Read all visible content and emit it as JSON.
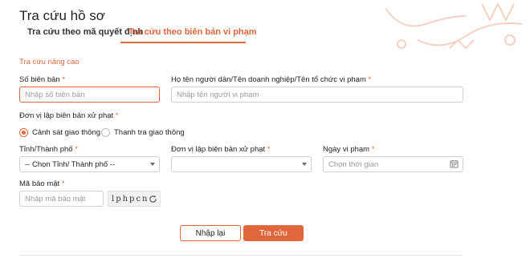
{
  "page": {
    "title": "Tra cứu hồ sơ"
  },
  "tabs": [
    {
      "label": "Tra cứu theo mã quyết định",
      "active": false
    },
    {
      "label": "Tra cứu theo biên bản vi phạm",
      "active": true
    }
  ],
  "section": {
    "label": "Tra cứu nâng cao"
  },
  "form": {
    "so_bien_ban": {
      "label": "Số biên bản",
      "required": "*",
      "placeholder": "Nhập số biên bản",
      "value": ""
    },
    "ho_ten": {
      "label": "Họ tên người dân/Tên doanh nghiệp/Tên tổ chức vi phạm",
      "required": "*",
      "placeholder": "Nhập tên người vi phạm",
      "value": ""
    },
    "don_vi_group": {
      "label": "Đơn vị lập biên bản xử phạt",
      "required": "*"
    },
    "radios": [
      {
        "label": "Cảnh sát giao thông",
        "checked": true
      },
      {
        "label": "Thanh tra giao thông",
        "checked": false
      }
    ],
    "tinh_thanh": {
      "label": "Tỉnh/Thành phố",
      "required": "*",
      "selected": "-- Chọn Tỉnh/ Thành phố --"
    },
    "don_vi_select": {
      "label": "Đơn vị lập biên bản xử phạt",
      "required": "*",
      "selected": ""
    },
    "ngay_vi_pham": {
      "label": "Ngày vi phạm",
      "required": "*",
      "placeholder": "Chọn thời gian",
      "value": ""
    },
    "ma_bao_mat": {
      "label": "Mã bảo mật",
      "required": "*",
      "placeholder": "Nhập mã bảo mật",
      "value": "",
      "captcha_text": "lphpcn"
    }
  },
  "buttons": {
    "reset": "Nhập lại",
    "search": "Tra cứu"
  },
  "colors": {
    "accent": "#e0673c"
  },
  "icons": {
    "calendar": "calendar-icon",
    "refresh": "refresh-icon",
    "dropdown": "chevron-down-icon"
  }
}
